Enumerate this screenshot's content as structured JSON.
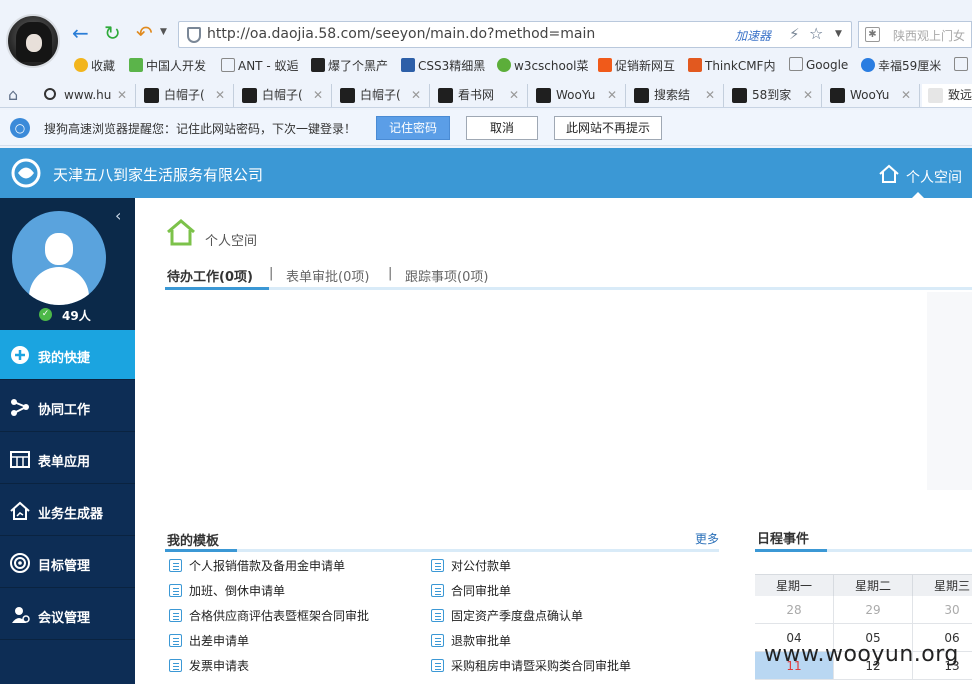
{
  "browser": {
    "url": "http://oa.daojia.58.com/seeyon/main.do?method=main",
    "accelerator_label": "加速器",
    "search_placeholder": "陕西观上门女",
    "bookmarks": [
      {
        "label": "收藏",
        "icon": "star-icon"
      },
      {
        "label": "中国人开发",
        "icon": "leaf-icon"
      },
      {
        "label": "ANT - 蚁逅",
        "icon": "page-icon"
      },
      {
        "label": "爆了个黑产",
        "icon": "hat-icon"
      },
      {
        "label": "CSS3精细黑",
        "icon": "w-icon"
      },
      {
        "label": "w3cschool菜",
        "icon": "w3c-icon"
      },
      {
        "label": "促销新网互",
        "icon": "taobao-icon"
      },
      {
        "label": "ThinkCMF内",
        "icon": "thinkcmf-icon"
      },
      {
        "label": "Google",
        "icon": "page-icon"
      },
      {
        "label": "幸福59厘米",
        "icon": "youku-icon"
      }
    ],
    "tabs": [
      "www.hu",
      "白帽子(",
      "白帽子(",
      "白帽子(",
      "看书网",
      "WooYu",
      "搜索结",
      "58到家",
      "WooYu",
      "致远"
    ],
    "notification": {
      "text": "搜狗高速浏览器提醒您：记住此网站密码，下次一键登录！",
      "remember_button": "记住密码",
      "cancel_button": "取消",
      "never_button": "此网站不再提示"
    }
  },
  "app": {
    "company_name": "天津五八到家生活服务有限公司",
    "space_link": "个人空间",
    "accent_color": "#3b98d5",
    "sidebar": {
      "online_count": "49人",
      "items": [
        {
          "label": "我的快捷",
          "icon": "plus-circle-icon",
          "active": true
        },
        {
          "label": "协同工作",
          "icon": "share-icon",
          "active": false
        },
        {
          "label": "表单应用",
          "icon": "calendar-form-icon",
          "active": false
        },
        {
          "label": "业务生成器",
          "icon": "home-chart-icon",
          "active": false
        },
        {
          "label": "目标管理",
          "icon": "target-icon",
          "active": false
        },
        {
          "label": "会议管理",
          "icon": "meeting-icon",
          "active": false
        }
      ]
    },
    "breadcrumb_title": "个人空间",
    "work_tabs": [
      "待办工作(0项)",
      "表单审批(0项)",
      "跟踪事项(0项)"
    ],
    "tab_separator": "|",
    "templates": {
      "title": "我的模板",
      "more": "更多",
      "items": [
        "个人报销借款及备用金申请单",
        "对公付款单",
        "加班、倒休申请单",
        "合同审批单",
        "合格供应商评估表暨框架合同审批",
        "固定资产季度盘点确认单",
        "出差申请单",
        "退款审批单",
        "发票申请表",
        "采购租房申请暨采购类合同审批单"
      ]
    },
    "schedule": {
      "title": "日程事件",
      "weekdays": [
        "星期一",
        "星期二",
        "星期三"
      ],
      "rows": [
        [
          "28",
          "29",
          "30"
        ],
        [
          "04",
          "05",
          "06"
        ],
        [
          "11",
          "12",
          "13"
        ]
      ],
      "prev_month_row": 0,
      "today": "11"
    }
  },
  "watermark": "www.wooyun.org"
}
